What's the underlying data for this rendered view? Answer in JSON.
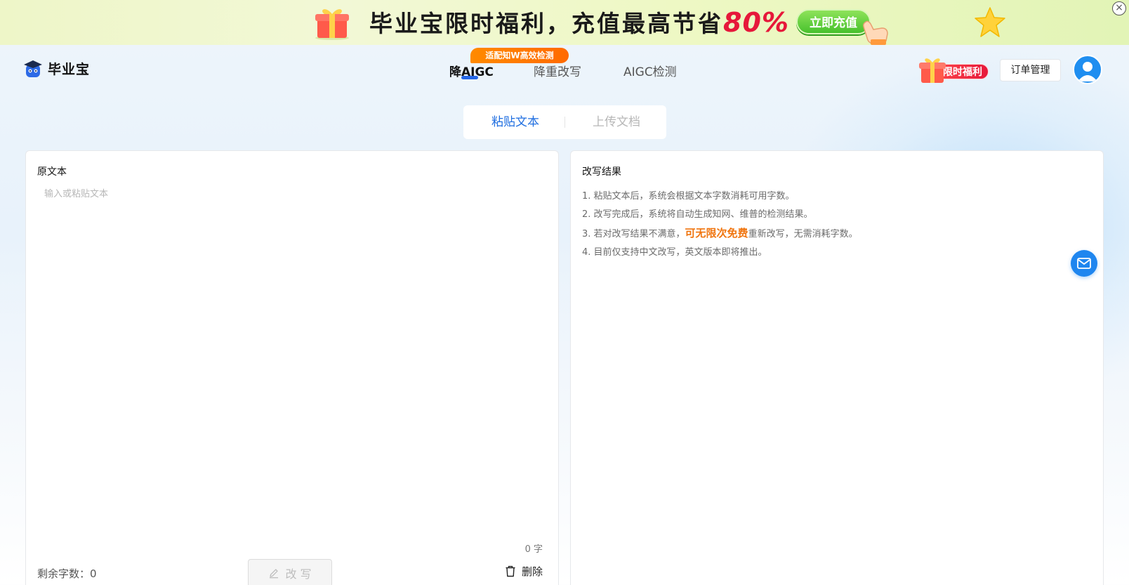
{
  "banner": {
    "text_main": "毕业宝限时福利，充值最高节省",
    "text_highlight": "80%",
    "cta_label": "立即充值",
    "close_glyph": "×"
  },
  "header": {
    "logo_text": "毕业宝",
    "nav": [
      {
        "label": "降AIGC",
        "active": true
      },
      {
        "label": "降重改写",
        "active": false
      },
      {
        "label": "AIGC检测",
        "active": false
      }
    ],
    "nav_badge": "适配知W高效检测",
    "promo_label": "限时福利",
    "order_button": "订单管理"
  },
  "mode_tabs": [
    {
      "label": "粘贴文本",
      "active": true
    },
    {
      "label": "上传文档",
      "active": false
    }
  ],
  "source_panel": {
    "title": "原文本",
    "placeholder": "输入或粘贴文本",
    "word_count": "0 字",
    "remaining_label": "剩余字数：",
    "remaining_value": "0",
    "rewrite_button": "改 写",
    "delete_button": "删除"
  },
  "result_panel": {
    "title": "改写结果",
    "tips": [
      {
        "text": "1. 粘贴文本后，系统会根据文本字数消耗可用字数。"
      },
      {
        "text": "2. 改写完成后，系统将自动生成知网、维普的检测结果。"
      },
      {
        "prefix": "3. 若对改写结果不满意，",
        "highlight": "可无限次免费",
        "suffix": "重新改写，无需消耗字数。"
      },
      {
        "text": "4. 目前仅支持中文改写，英文版本即将推出。"
      }
    ]
  },
  "colors": {
    "accent_blue": "#1f6ee0",
    "highlight_orange": "#f0750f",
    "banner_red": "#e6183a",
    "badge_orange": "#ff7a00"
  },
  "icons": {
    "banner_gift": "gift-icon",
    "banner_hand": "pointing-hand-icon",
    "banner_star": "star-icon",
    "logo": "mascot-logo-icon",
    "promo": "gift-icon",
    "avatar": "user-avatar-icon",
    "rewrite": "pencil-icon",
    "delete": "trash-icon",
    "mail": "mail-icon"
  }
}
